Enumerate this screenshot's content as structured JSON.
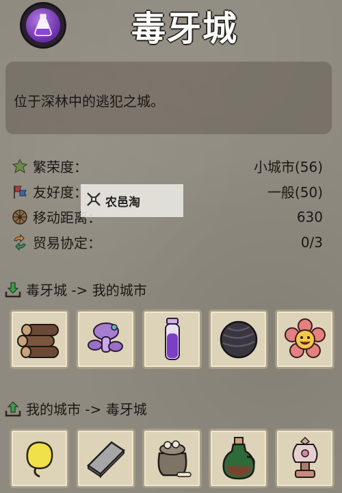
{
  "header": {
    "title": "毒牙城",
    "logo_icon": "potion-icon"
  },
  "description": "位于深林中的逃犯之城。",
  "stats": [
    {
      "label": "繁荣度：",
      "value": "小城市(56)",
      "icon": "prosperity-leaf-icon"
    },
    {
      "label": "友好度：",
      "value": "一般(50)",
      "icon": "flag-icon"
    },
    {
      "label": "移动距离：",
      "value": "630",
      "icon": "wheel-icon"
    },
    {
      "label": "贸易协定：",
      "value": "0/3",
      "icon": "trade-arrows-icon"
    }
  ],
  "watermark": "农邑淘",
  "exports": {
    "title": "毒牙城 -> 我的城市",
    "items": [
      "log-icon",
      "purple-mushroom-icon",
      "purple-potion-icon",
      "dark-ball-icon",
      "flower-face-icon"
    ]
  },
  "imports": {
    "title": "我的城市 -> 毒牙城",
    "items": [
      "yellow-seed-icon",
      "metal-bar-icon",
      "bone-sack-icon",
      "green-bottle-icon",
      "ornate-vase-icon"
    ]
  },
  "colors": {
    "accent_purple": "#7a3cc0",
    "item_bg": "#ddd3b8",
    "arrow_green": "#3f9a4a"
  }
}
